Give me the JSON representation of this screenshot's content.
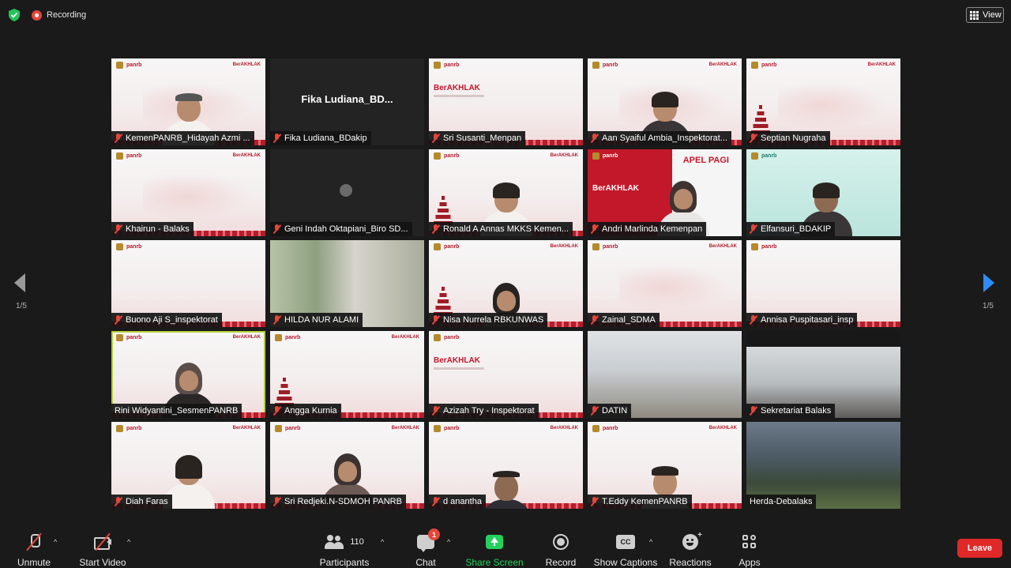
{
  "topbar": {
    "security_icon": "shield-check-icon",
    "recording_label": "Recording",
    "view_label": "View"
  },
  "pagination": {
    "prev_page": "1/5",
    "next_page": "1/5"
  },
  "colors": {
    "background": "#1a1a1a",
    "muted_red": "#e5463b",
    "share_green": "#24d15d",
    "leave_red": "#e02828",
    "active_speaker": "#b6cf3a",
    "next_arrow_blue": "#2d8cff"
  },
  "tiles": [
    {
      "name": "KemenPANRB_Hidayah Azmi ...",
      "muted": true
    },
    {
      "name": "Fika Ludiana_BDakip",
      "muted": true,
      "video_off_title": "Fika  Ludiana_BD..."
    },
    {
      "name": "Sri Susanti_Menpan",
      "muted": true
    },
    {
      "name": "Aan Syaiful Ambia_Inspektorat...",
      "muted": true
    },
    {
      "name": "Septian Nugraha",
      "muted": true
    },
    {
      "name": "Khairun - Balaks",
      "muted": true
    },
    {
      "name": "Geni Indah Oktapiani_Biro SD...",
      "muted": true
    },
    {
      "name": "Ronald A Annas MKKS Kemen...",
      "muted": true
    },
    {
      "name": "Andri Marlinda Kemenpan",
      "muted": true,
      "slide_text": "APEL PAGI"
    },
    {
      "name": "Elfansuri_BDAKIP",
      "muted": true
    },
    {
      "name": "Buono Aji S_inspektorat",
      "muted": true
    },
    {
      "name": "HILDA NUR ALAMI",
      "muted": true
    },
    {
      "name": "Nisa Nurrela RBKUNWAS",
      "muted": true
    },
    {
      "name": "Zainal_SDMA",
      "muted": true
    },
    {
      "name": "Annisa Puspitasari_insp",
      "muted": true
    },
    {
      "name": "Rini Widyantini_SesmenPANRB",
      "muted": false,
      "active_speaker": true
    },
    {
      "name": "Angga Kurnia",
      "muted": true
    },
    {
      "name": "Azizah Try - Inspektorat",
      "muted": true
    },
    {
      "name": "DATIN",
      "muted": true
    },
    {
      "name": "Sekretariat Balaks",
      "muted": true
    },
    {
      "name": "Diah Faras",
      "muted": true
    },
    {
      "name": "Sri Redjeki.N-SDMOH PANRB",
      "muted": true
    },
    {
      "name": "d anantha",
      "muted": true
    },
    {
      "name": "T.Eddy KemenPANRB",
      "muted": true
    },
    {
      "name": "Herda-Debalaks",
      "muted": false
    }
  ],
  "toolbar": {
    "unmute": "Unmute",
    "start_video": "Start Video",
    "participants": "Participants",
    "participants_count": "110",
    "chat": "Chat",
    "chat_badge": "1",
    "share_screen": "Share Screen",
    "record": "Record",
    "show_captions": "Show Captions",
    "cc": "CC",
    "reactions": "Reactions",
    "apps": "Apps",
    "leave": "Leave"
  }
}
